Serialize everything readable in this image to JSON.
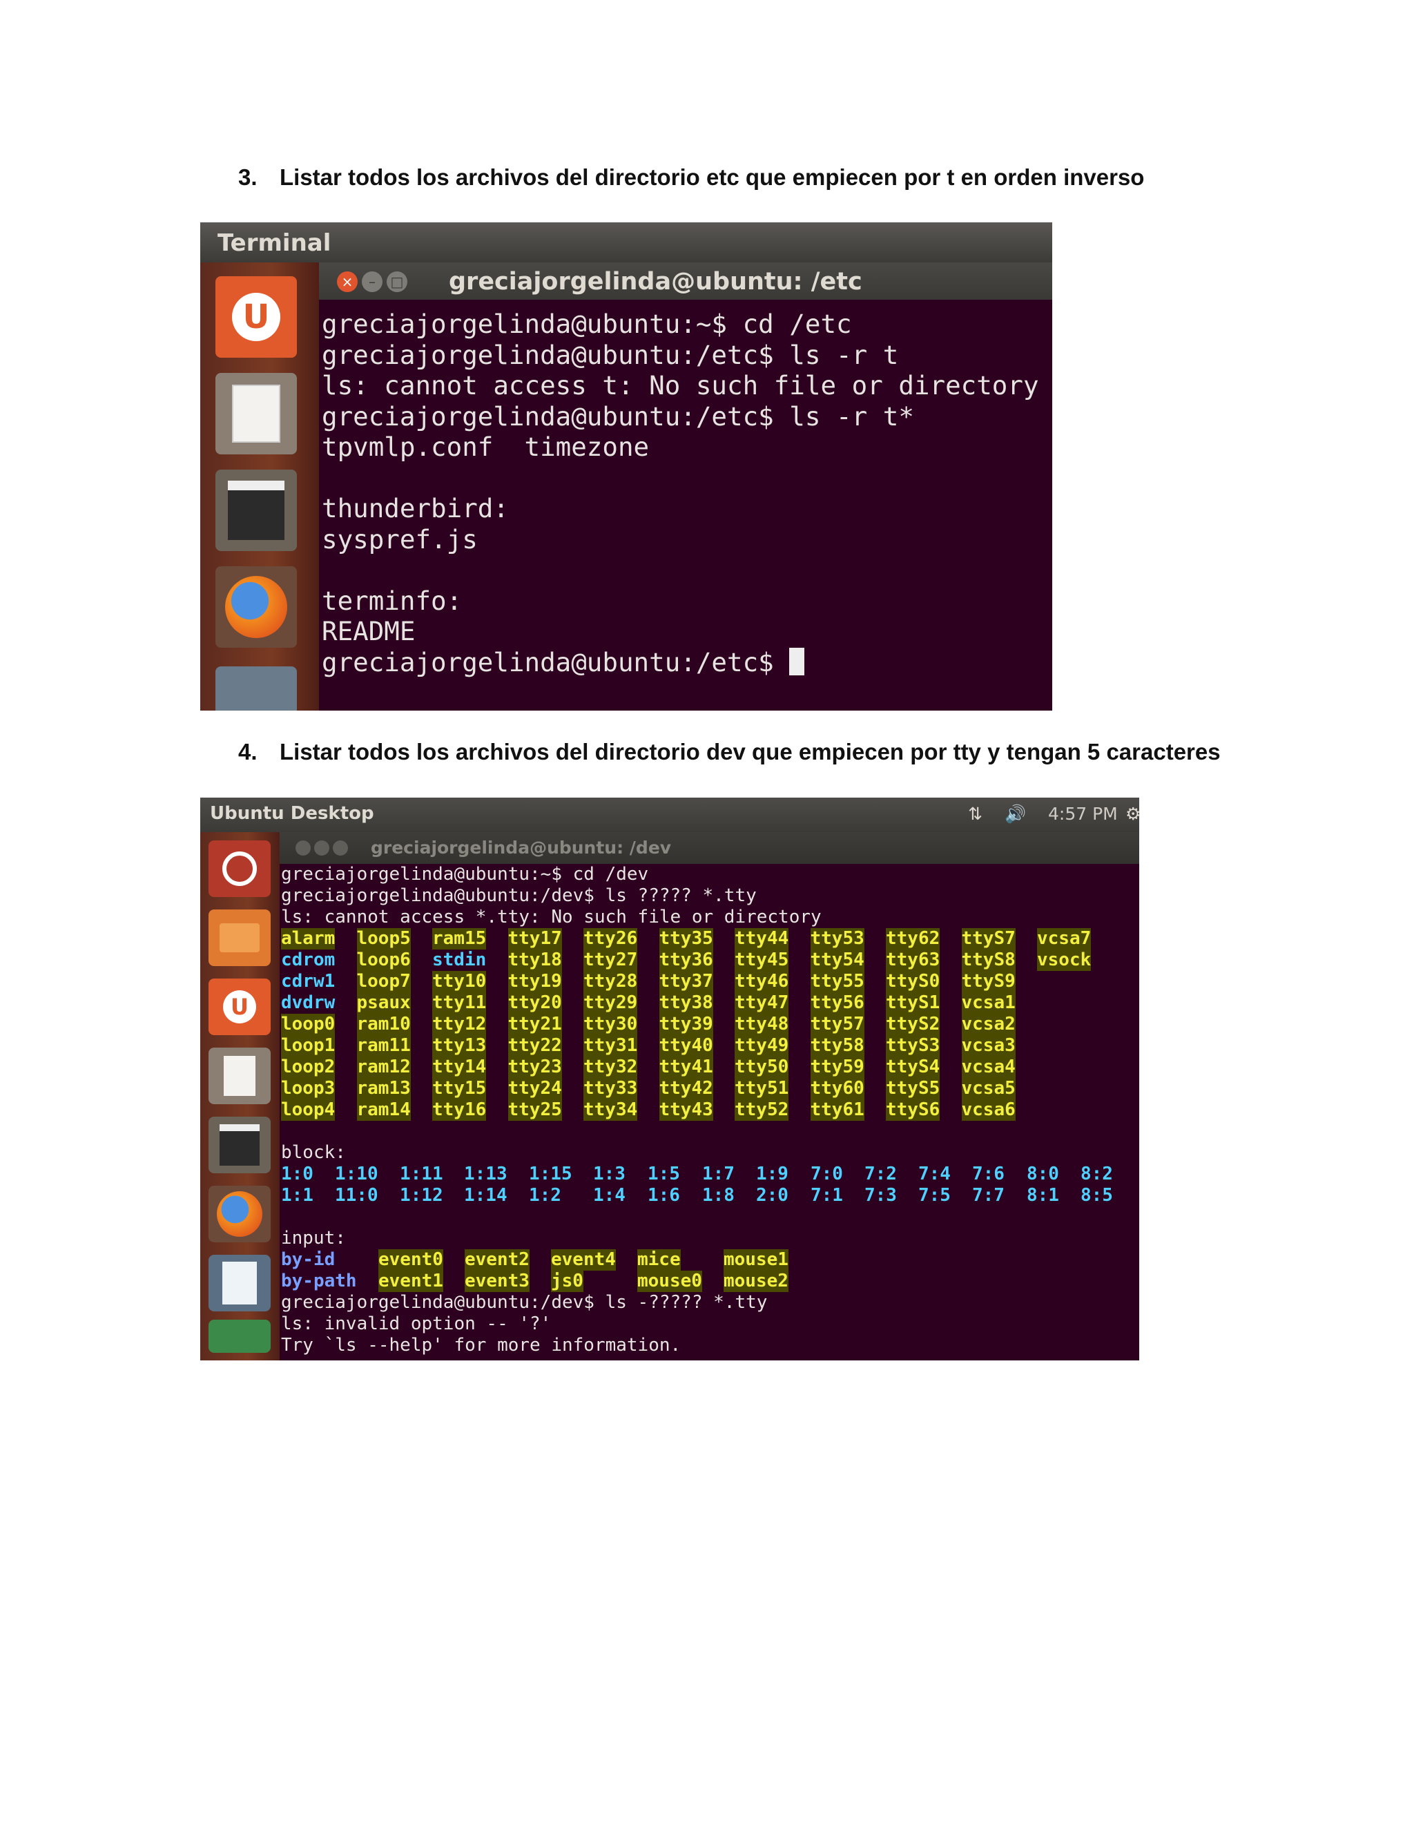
{
  "heading3": {
    "num": "3.",
    "text": "Listar todos los archivos del directorio etc que empiecen por t en orden inverso"
  },
  "heading4": {
    "num": "4.",
    "text": "Listar todos los archivos del directorio dev que empiecen por tty y tengan 5 caracteres"
  },
  "shot1": {
    "app_title": "Terminal",
    "window_title": "greciajorgelinda@ubuntu: /etc",
    "lines": [
      "greciajorgelinda@ubuntu:~$ cd /etc",
      "greciajorgelinda@ubuntu:/etc$ ls -r t",
      "ls: cannot access t: No such file or directory",
      "greciajorgelinda@ubuntu:/etc$ ls -r t*",
      "tpvmlp.conf  timezone",
      "",
      "thunderbird:",
      "syspref.js",
      "",
      "terminfo:",
      "README",
      "greciajorgelinda@ubuntu:/etc$ "
    ]
  },
  "shot2": {
    "panel_title": "Ubuntu Desktop",
    "clock": "4:57 PM",
    "window_title": "greciajorgelinda@ubuntu: /dev",
    "pre_lines": [
      "greciajorgelinda@ubuntu:~$ cd /dev",
      "greciajorgelinda@ubuntu:/dev$ ls ????? *.tty",
      "ls: cannot access *.tty: No such file or directory"
    ],
    "dev_grid": [
      [
        "alarm",
        "loop5",
        "ram15",
        "tty17",
        "tty26",
        "tty35",
        "tty44",
        "tty53",
        "tty62",
        "ttyS7",
        "vcsa7"
      ],
      [
        "cdrom",
        "loop6",
        "stdin",
        "tty18",
        "tty27",
        "tty36",
        "tty45",
        "tty54",
        "tty63",
        "ttyS8",
        "vsock"
      ],
      [
        "cdrw1",
        "loop7",
        "tty10",
        "tty19",
        "tty28",
        "tty37",
        "tty46",
        "tty55",
        "ttyS0",
        "ttyS9",
        ""
      ],
      [
        "dvdrw",
        "psaux",
        "tty11",
        "tty20",
        "tty29",
        "tty38",
        "tty47",
        "tty56",
        "ttyS1",
        "vcsa1",
        ""
      ],
      [
        "loop0",
        "ram10",
        "tty12",
        "tty21",
        "tty30",
        "tty39",
        "tty48",
        "tty57",
        "ttyS2",
        "vcsa2",
        ""
      ],
      [
        "loop1",
        "ram11",
        "tty13",
        "tty22",
        "tty31",
        "tty40",
        "tty49",
        "tty58",
        "ttyS3",
        "vcsa3",
        ""
      ],
      [
        "loop2",
        "ram12",
        "tty14",
        "tty23",
        "tty32",
        "tty41",
        "tty50",
        "tty59",
        "ttyS4",
        "vcsa4",
        ""
      ],
      [
        "loop3",
        "ram13",
        "tty15",
        "tty24",
        "tty33",
        "tty42",
        "tty51",
        "tty60",
        "ttyS5",
        "vcsa5",
        ""
      ],
      [
        "loop4",
        "ram14",
        "tty16",
        "tty25",
        "tty34",
        "tty43",
        "tty52",
        "tty61",
        "ttyS6",
        "vcsa6",
        ""
      ]
    ],
    "block_label": "block:",
    "block_grid": [
      [
        "1:0",
        "1:10",
        "1:11",
        "1:13",
        "1:15",
        "1:3",
        "1:5",
        "1:7",
        "1:9",
        "7:0",
        "7:2",
        "7:4",
        "7:6",
        "8:0",
        "8:2"
      ],
      [
        "1:1",
        "11:0",
        "1:12",
        "1:14",
        "1:2",
        "1:4",
        "1:6",
        "1:8",
        "2:0",
        "7:1",
        "7:3",
        "7:5",
        "7:7",
        "8:1",
        "8:5"
      ]
    ],
    "input_label": "input:",
    "input_grid": [
      [
        "by-id",
        "event0",
        "event2",
        "event4",
        "mice",
        "mouse1"
      ],
      [
        "by-path",
        "event1",
        "event3",
        "js0",
        "mouse0",
        "mouse2"
      ]
    ],
    "post_lines": [
      "greciajorgelinda@ubuntu:/dev$ ls -????? *.tty",
      "ls: invalid option -- '?'",
      "Try `ls --help' for more information."
    ]
  }
}
